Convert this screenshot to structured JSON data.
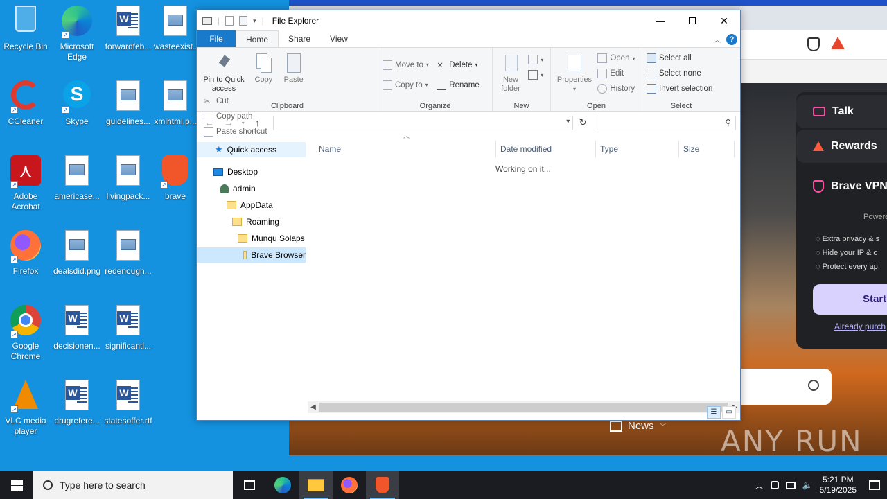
{
  "desktop": {
    "icons": [
      {
        "label": "Recycle Bin"
      },
      {
        "label": "Microsoft Edge"
      },
      {
        "label": "forwardfeb..."
      },
      {
        "label": "wasteexist..."
      },
      {
        "label": "CCleaner"
      },
      {
        "label": "Skype"
      },
      {
        "label": "guidelines..."
      },
      {
        "label": "xmlhtml.p..."
      },
      {
        "label": "Adobe Acrobat"
      },
      {
        "label": "americase..."
      },
      {
        "label": "livingpack..."
      },
      {
        "label": "brave"
      },
      {
        "label": "Firefox"
      },
      {
        "label": "dealsdid.png"
      },
      {
        "label": "redenough..."
      },
      {
        "label": "Google Chrome"
      },
      {
        "label": "decisionen..."
      },
      {
        "label": "significantl..."
      },
      {
        "label": "VLC media player"
      },
      {
        "label": "drugrefere..."
      },
      {
        "label": "statesoffer.rtf"
      }
    ]
  },
  "browser": {
    "panel": {
      "talk": "Talk",
      "rewards": "Rewards",
      "vpn": "Brave VPN",
      "powered": "Powered",
      "features": [
        "Extra privacy & s",
        "Hide your IP & c",
        "Protect every ap"
      ],
      "start": "Start",
      "already": "Already purch"
    },
    "news": "News",
    "watermark": "ANY RUN"
  },
  "explorer": {
    "title": "File Explorer",
    "tabs": {
      "file": "File",
      "home": "Home",
      "share": "Share",
      "view": "View"
    },
    "help": "?",
    "ribbon": {
      "clipboard": {
        "label": "Clipboard",
        "pin": "Pin to Quick access",
        "copy": "Copy",
        "paste": "Paste",
        "cut": "Cut",
        "copy_path": "Copy path",
        "paste_shortcut": "Paste shortcut"
      },
      "organize": {
        "label": "Organize",
        "move_to": "Move to",
        "copy_to": "Copy to",
        "delete": "Delete",
        "rename": "Rename"
      },
      "new": {
        "label": "New",
        "new_folder": "New folder"
      },
      "open": {
        "label": "Open",
        "properties": "Properties",
        "open": "Open",
        "edit": "Edit",
        "history": "History"
      },
      "select": {
        "label": "Select",
        "select_all": "Select all",
        "select_none": "Select none",
        "invert": "Invert selection"
      }
    },
    "address": {
      "value": "",
      "search_placeholder": ""
    },
    "nav_tree": [
      {
        "label": "Quick access"
      },
      {
        "label": "Desktop"
      },
      {
        "label": "admin"
      },
      {
        "label": "AppData"
      },
      {
        "label": "Roaming"
      },
      {
        "label": "Munqu Solaps"
      },
      {
        "label": "Brave Browser"
      }
    ],
    "columns": [
      "Name",
      "Date modified",
      "Type",
      "Size"
    ],
    "status_message": "Working on it..."
  },
  "taskbar": {
    "search_placeholder": "Type here to search",
    "time": "5:21 PM",
    "date": "5/19/2025"
  }
}
